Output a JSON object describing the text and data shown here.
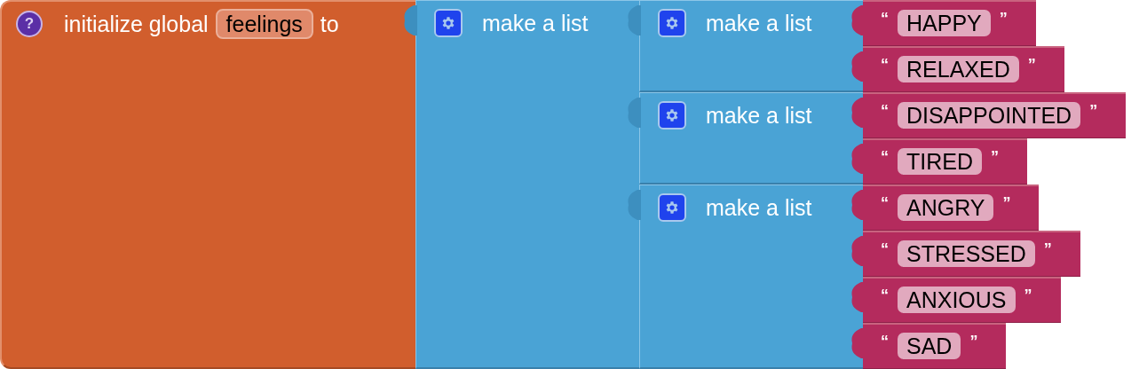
{
  "init_block": {
    "help": "?",
    "keyword": "initialize global",
    "variable": "feelings",
    "to": "to"
  },
  "outer_list": {
    "label": "make a list",
    "lists": [
      {
        "label": "make a list",
        "items": [
          {
            "open": "“",
            "text": "HAPPY",
            "close": "”"
          },
          {
            "open": "“",
            "text": "RELAXED",
            "close": "”"
          }
        ]
      },
      {
        "label": "make a list",
        "items": [
          {
            "open": "“",
            "text": "DISAPPOINTED",
            "close": "”"
          },
          {
            "open": "“",
            "text": "TIRED",
            "close": "”"
          }
        ]
      },
      {
        "label": "make a list",
        "items": [
          {
            "open": "“",
            "text": "ANGRY",
            "close": "”"
          },
          {
            "open": "“",
            "text": "STRESSED",
            "close": "”"
          },
          {
            "open": "“",
            "text": "ANXIOUS",
            "close": "”"
          },
          {
            "open": "“",
            "text": "SAD",
            "close": "”"
          }
        ]
      }
    ]
  }
}
